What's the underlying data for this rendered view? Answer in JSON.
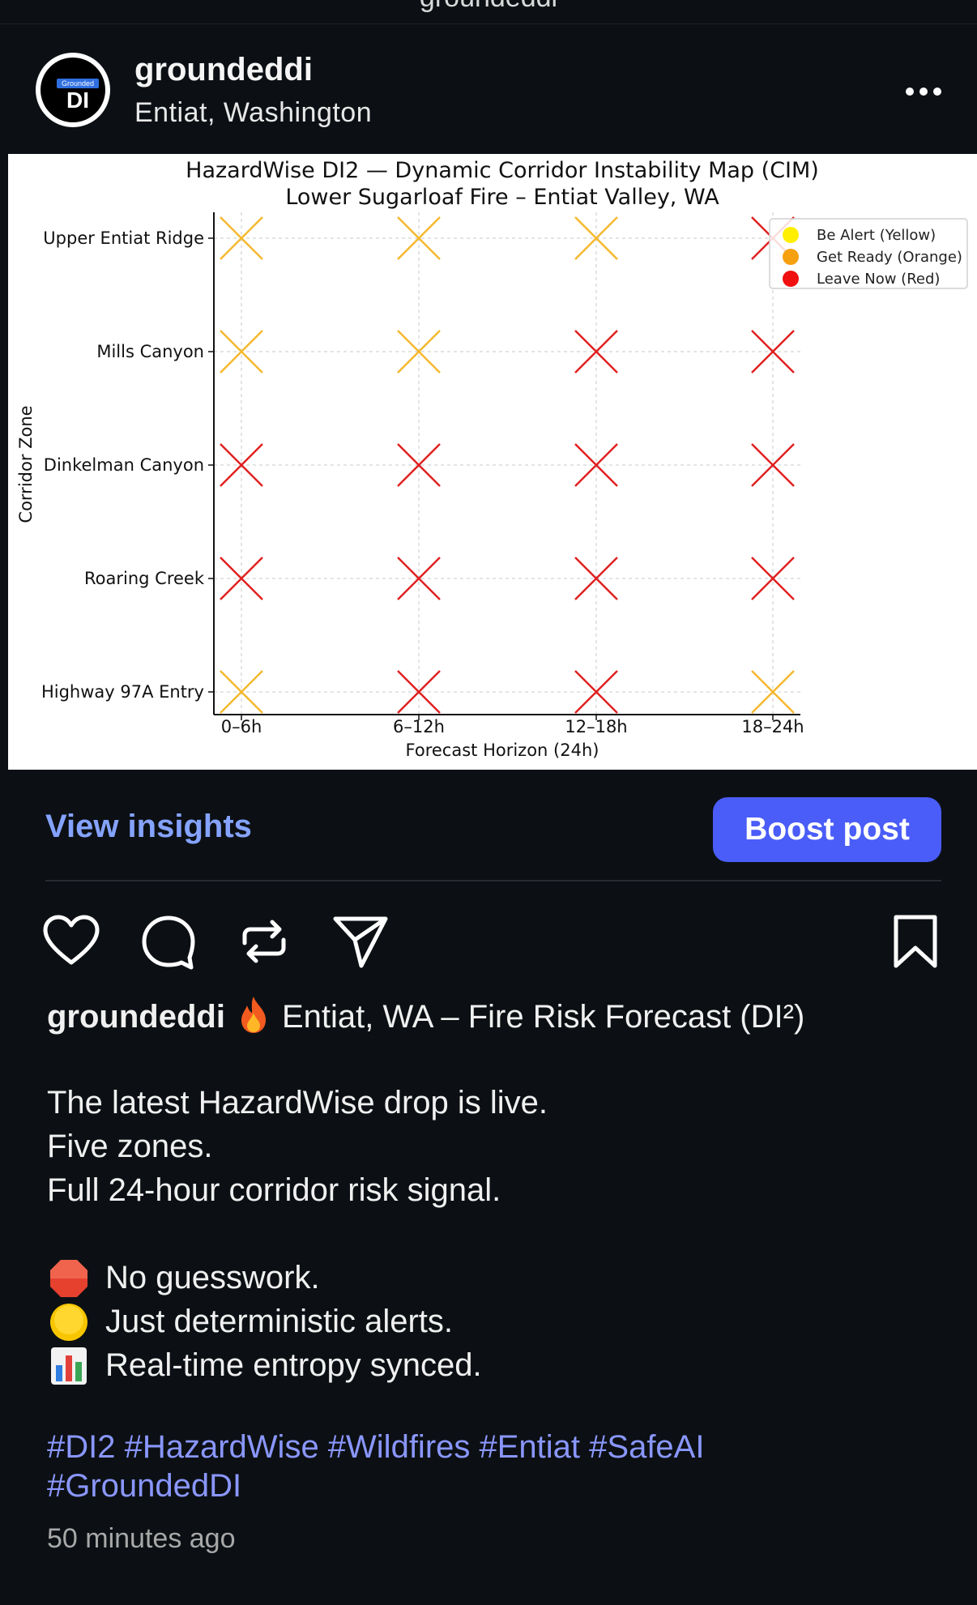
{
  "page_title_partial": "groundeddi",
  "post": {
    "username": "groundeddi",
    "location": "Entiat, Washington",
    "avatar": {
      "badge_text": "Grounded",
      "initials": "DI"
    }
  },
  "insights": {
    "view_label": "View insights",
    "boost_label": "Boost post"
  },
  "caption": {
    "username": "groundeddi",
    "headline": "Entiat, WA – Fire Risk Forecast (DI²)",
    "lines": [
      "The latest HazardWise drop is live.",
      "Five zones.",
      "Full 24-hour corridor risk signal."
    ],
    "emoji_lines": [
      {
        "icon": "stop-sign-icon",
        "text": "No guesswork."
      },
      {
        "icon": "yellow-circle-icon",
        "text": "Just deterministic alerts."
      },
      {
        "icon": "bar-chart-icon",
        "text": "Real-time entropy synced."
      }
    ],
    "hashtags_line1": "#DI2 #HazardWise #Wildfires #Entiat #SafeAI",
    "hashtags_line2": "#GroundedDI",
    "time_ago": "50 minutes ago"
  },
  "colors": {
    "background": "#0c1014",
    "accent_link": "#85a3ff",
    "boost_button": "#4a5df9",
    "hashtag": "#8a97ff",
    "alert_yellow": "#f5b82e",
    "alert_orange": "#f5a623",
    "alert_red": "#e02020"
  },
  "chart_data": {
    "type": "scatter",
    "title": "HazardWise DI2 — Dynamic Corridor Instability Map (CIM)",
    "subtitle": "Lower Sugarloaf Fire – Entiat Valley, WA",
    "xlabel": "Forecast Horizon (24h)",
    "ylabel": "Corridor Zone",
    "categories": [
      "0–6h",
      "6–12h",
      "12–18h",
      "18–24h"
    ],
    "zones": [
      "Upper Entiat Ridge",
      "Mills Canyon",
      "Dinkelman Canyon",
      "Roaring Creek",
      "Highway 97A Entry"
    ],
    "grid": true,
    "marker": "x",
    "legend_position": "top-right",
    "legend": [
      {
        "label": "Be Alert (Yellow)",
        "color": "#ffee00"
      },
      {
        "label": "Get Ready (Orange)",
        "color": "#f5a00f"
      },
      {
        "label": "Leave Now (Red)",
        "color": "#f01010"
      }
    ],
    "status_colors": {
      "yellow": "#f5b82e",
      "red": "#e02020"
    },
    "values": [
      [
        "yellow",
        "yellow",
        "yellow",
        "red"
      ],
      [
        "yellow",
        "yellow",
        "red",
        "red"
      ],
      [
        "red",
        "red",
        "red",
        "red"
      ],
      [
        "red",
        "red",
        "red",
        "red"
      ],
      [
        "yellow",
        "red",
        "red",
        "yellow"
      ]
    ]
  }
}
